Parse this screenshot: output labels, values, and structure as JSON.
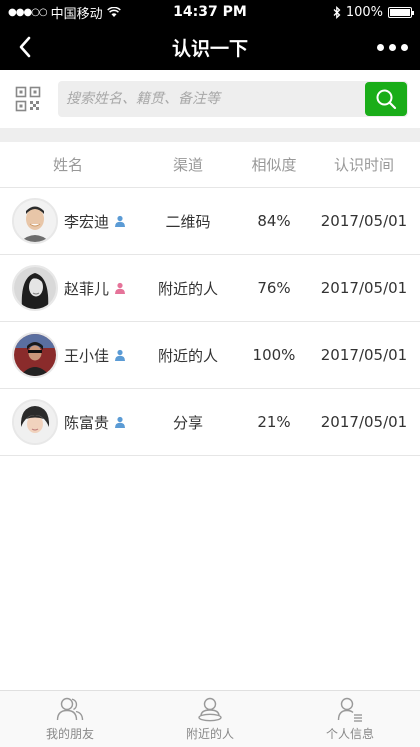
{
  "status_bar": {
    "signal": "●●●○○",
    "carrier": "中国移动",
    "time": "14:37 PM",
    "bluetooth_icon": "bluetooth-icon",
    "battery": "100%",
    "battery_level": 1.0
  },
  "nav": {
    "title": "认识一下",
    "back_icon": "back-chevron-icon",
    "more_icon": "more-dots-icon"
  },
  "search": {
    "placeholder": "搜索姓名、籍贯、备注等",
    "qr_icon": "qr-code-icon",
    "search_icon": "search-icon"
  },
  "table": {
    "headers": [
      "姓名",
      "渠道",
      "相似度",
      "认识时间"
    ],
    "rows": [
      {
        "name": "李宏迪",
        "gender_icon": "male-person-icon",
        "channel": "二维码",
        "similarity": "84%",
        "time": "2017/05/01"
      },
      {
        "name": "赵菲儿",
        "gender_icon": "female-person-icon",
        "channel": "附近的人",
        "similarity": "76%",
        "time": "2017/05/01"
      },
      {
        "name": "王小佳",
        "gender_icon": "male-person-icon",
        "channel": "附近的人",
        "similarity": "100%",
        "time": "2017/05/01"
      },
      {
        "name": "陈富贵",
        "gender_icon": "male-person-icon",
        "channel": "分享",
        "similarity": "21%",
        "time": "2017/05/01"
      }
    ]
  },
  "tabs": [
    {
      "label": "我的朋友",
      "icon": "friends-icon"
    },
    {
      "label": "附近的人",
      "icon": "nearby-icon"
    },
    {
      "label": "个人信息",
      "icon": "profile-icon"
    }
  ],
  "colors": {
    "accent_green": "#1aad19",
    "male_blue": "#5b9bd5",
    "female_pink": "#e57399"
  }
}
